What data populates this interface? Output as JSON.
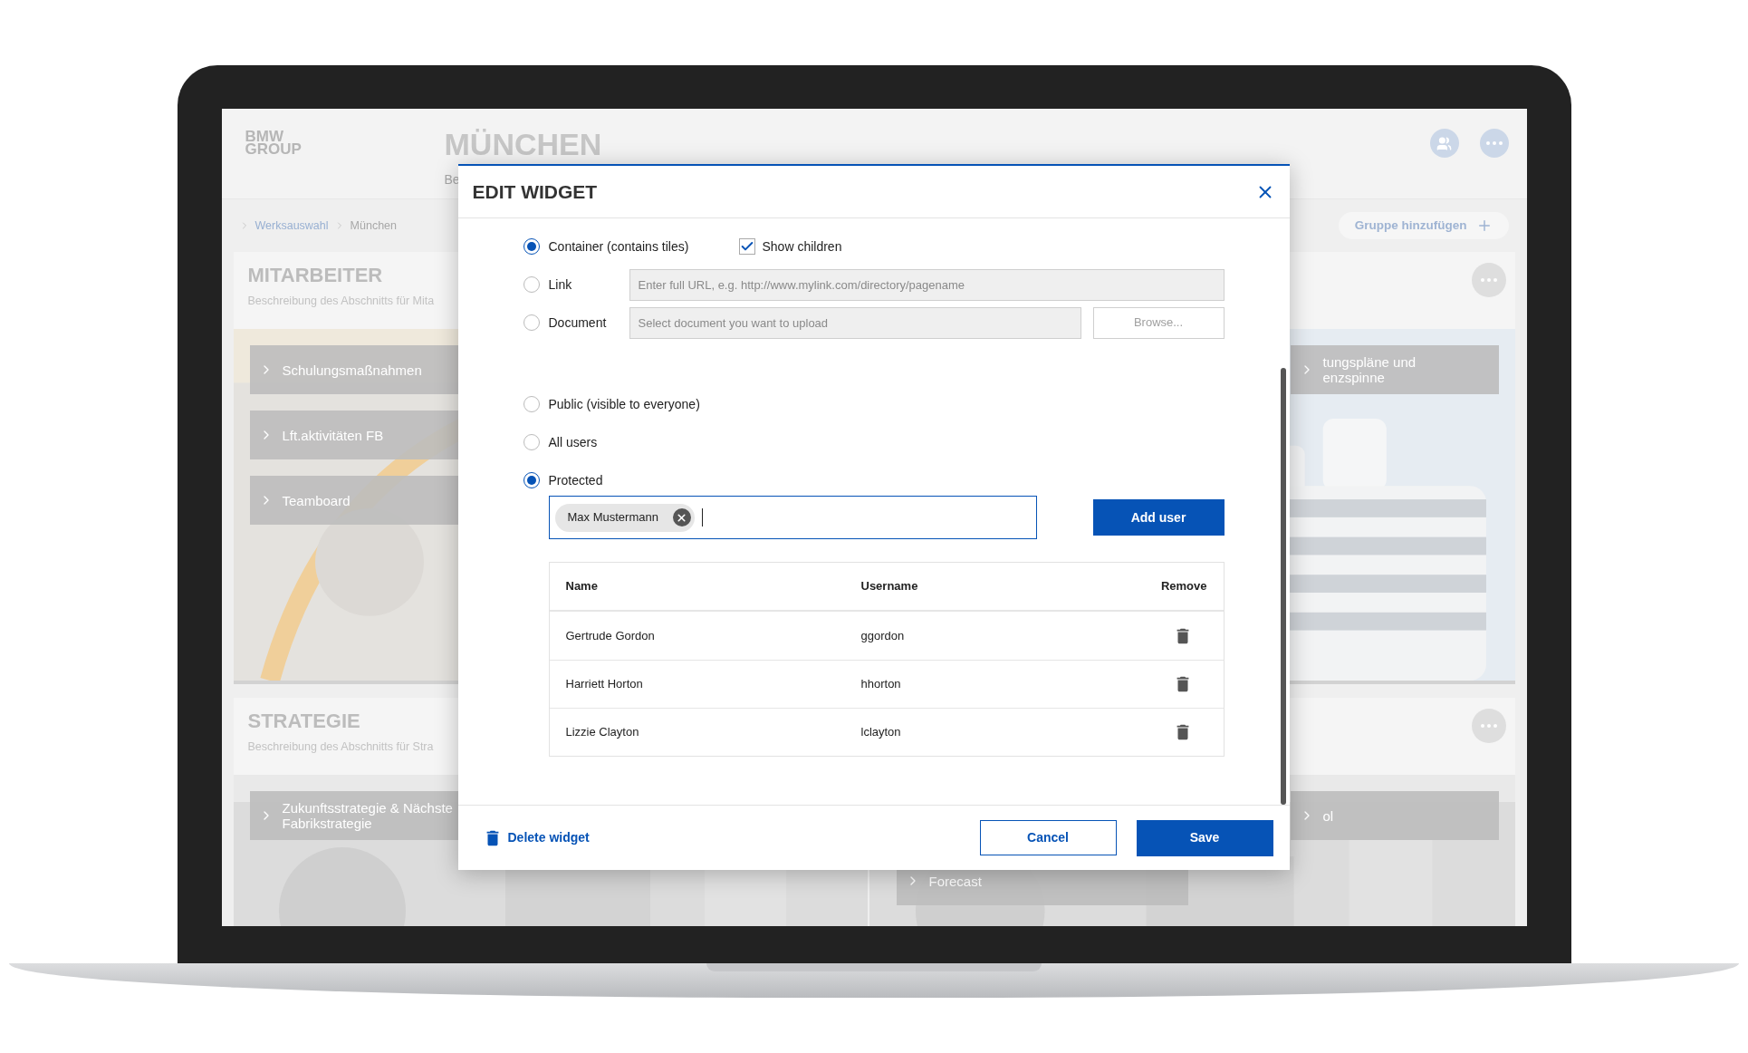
{
  "app": {
    "logo": [
      "BMW",
      "GROUP"
    ],
    "title": "MÜNCHEN",
    "subtitle": "Be",
    "breadcrumb": [
      {
        "label": "Werksauswahl",
        "kind": "link"
      },
      {
        "label": "München",
        "kind": "current"
      }
    ],
    "add_group_button": "Gruppe hinzufügen",
    "sections": [
      {
        "title": "MITARBEITER",
        "description": "Beschreibung des Abschnitts für Mita",
        "tiles_left": [
          "Schulungsmaßnahmen",
          "Lft.aktivitäten FB",
          "Teamboard"
        ],
        "tiles_right": [
          [
            "tungspläne und",
            "enzspinne"
          ]
        ]
      },
      {
        "title": "STRATEGIE",
        "description": "Beschreibung des Abschnitts für Stra",
        "tiles_left": [
          [
            "Zukunftsstrategie & Nächste",
            "Fabrikstrategie"
          ]
        ],
        "tiles_right": [
          [
            "ol"
          ]
        ],
        "tiles_lower": [
          "Forecast"
        ]
      }
    ]
  },
  "dialog": {
    "title": "EDIT WIDGET",
    "type_options": [
      {
        "kind": "container",
        "label": "Container (contains tiles)",
        "selected": true,
        "checkbox": {
          "label": "Show children",
          "checked": true
        }
      },
      {
        "kind": "link",
        "label": "Link",
        "selected": false,
        "field": {
          "placeholder": "Enter full URL, e.g. http://www.mylink.com/directory/pagename"
        }
      },
      {
        "kind": "document",
        "label": "Document",
        "selected": false,
        "field": {
          "placeholder": "Select document you want to upload"
        },
        "button": "Browse..."
      }
    ],
    "visibility_options": [
      {
        "label": "Public (visible to everyone)",
        "selected": false
      },
      {
        "label": "All users",
        "selected": false
      },
      {
        "label": "Protected",
        "selected": true
      }
    ],
    "user_field": {
      "chips": [
        "Max Mustermann"
      ]
    },
    "add_user_button": "Add user",
    "table": {
      "columns": [
        "Name",
        "Username",
        "Remove"
      ],
      "rows": [
        {
          "name": "Gertrude Gordon",
          "username": "ggordon"
        },
        {
          "name": "Harriett Horton",
          "username": "hhorton"
        },
        {
          "name": "Lizzie Clayton",
          "username": "lclayton"
        }
      ]
    },
    "delete_button": "Delete widget",
    "cancel_button": "Cancel",
    "save_button": "Save"
  }
}
